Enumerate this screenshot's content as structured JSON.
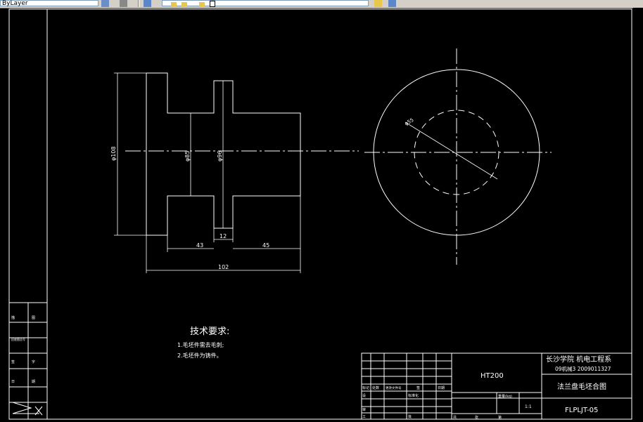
{
  "toolbar": {
    "layer_value": "ByLayer",
    "icons": [
      "layer-props-icon",
      "layer-state-icon",
      "layer-prev-icon",
      "match-prop-icon",
      "bulb-icon",
      "sun-icon",
      "lock-icon",
      "color-icon",
      "layer-extra-icon"
    ]
  },
  "drawing": {
    "dims": {
      "d_left": "φ108",
      "d_neck": "φ85",
      "d_flange": "φ96",
      "w_flange": "12",
      "w_43": "43",
      "w_45": "45",
      "total": "102",
      "d_circle": "φ55"
    },
    "notes": {
      "title": "技术要求:",
      "line1": "1.毛坯件需去毛刺;",
      "line2": "2.毛坯件为铸件。"
    },
    "titleblock": {
      "school": "长沙学院  机电工程系",
      "class_id": "09机械3   2009011327",
      "material": "HT200",
      "part_name": "法兰盘毛坯合图",
      "drawing_no": "FLPLJT-05",
      "weight_label": "重量(kg)",
      "scale": "1:1",
      "row_labels": [
        "标记",
        "处数",
        "更改文件号",
        "签",
        "字",
        "日期",
        "设",
        "计",
        "标准化",
        "审",
        "核",
        "工",
        "艺",
        "批",
        "准"
      ],
      "bottom_labels": [
        "共",
        "张",
        "第",
        "张"
      ],
      "stage_labels": [
        "阶段标记",
        "重量(kg)",
        "比例"
      ]
    },
    "sidebar": {
      "labels": [
        "描",
        "图",
        "描校",
        "旧底图总号",
        "底图总号",
        "签",
        "字",
        "日",
        "期"
      ]
    }
  }
}
